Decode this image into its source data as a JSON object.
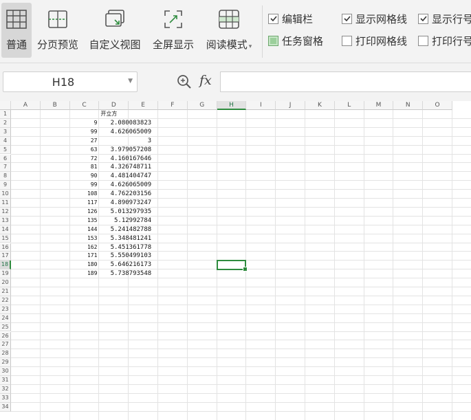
{
  "ribbon": {
    "buttons": [
      {
        "label": "普通",
        "icon": "normal-view-icon",
        "active": true
      },
      {
        "label": "分页预览",
        "icon": "page-break-preview-icon"
      },
      {
        "label": "自定义视图",
        "icon": "custom-view-icon"
      },
      {
        "label": "全屏显示",
        "icon": "fullscreen-icon"
      },
      {
        "label": "阅读模式",
        "icon": "reading-mode-icon",
        "dropdown": "▾"
      }
    ],
    "checks": [
      {
        "label": "编辑栏",
        "state": "checked"
      },
      {
        "label": "任务窗格",
        "state": "partial"
      },
      {
        "label": "显示网格线",
        "state": "checked"
      },
      {
        "label": "打印网格线",
        "state": "unchecked"
      },
      {
        "label": "显示行号",
        "state": "checked"
      },
      {
        "label": "打印行号",
        "state": "unchecked"
      }
    ]
  },
  "formula_bar": {
    "name_box": "H18",
    "fx_label": "fx",
    "formula": ""
  },
  "sheet": {
    "columns": [
      "A",
      "B",
      "C",
      "D",
      "E",
      "F",
      "G",
      "H",
      "I",
      "J",
      "K",
      "L",
      "M",
      "N",
      "O"
    ],
    "selected_column": "H",
    "row_count": 34,
    "selected_row": 18,
    "selected_cell": "H18",
    "header_d1": "开立方",
    "c_values": [
      "9",
      "99",
      "27",
      "63",
      "72",
      "81",
      "90",
      "99",
      "108",
      "117",
      "126",
      "135",
      "144",
      "153",
      "162",
      "171",
      "180",
      "189"
    ],
    "d_values": [
      "2.080083823",
      "4.626065009",
      "3",
      "3.979057208",
      "4.160167646",
      "4.326748711",
      "4.481404747",
      "4.626065009",
      "4.762203156",
      "4.890973247",
      "5.013297935",
      "5.12992784",
      "5.241482788",
      "5.348481241",
      "5.451361778",
      "5.550499103",
      "5.646216173",
      "5.738793548"
    ]
  },
  "colors": {
    "accent": "#2e8b3e",
    "ribbon_bg": "#f3f3f3"
  }
}
